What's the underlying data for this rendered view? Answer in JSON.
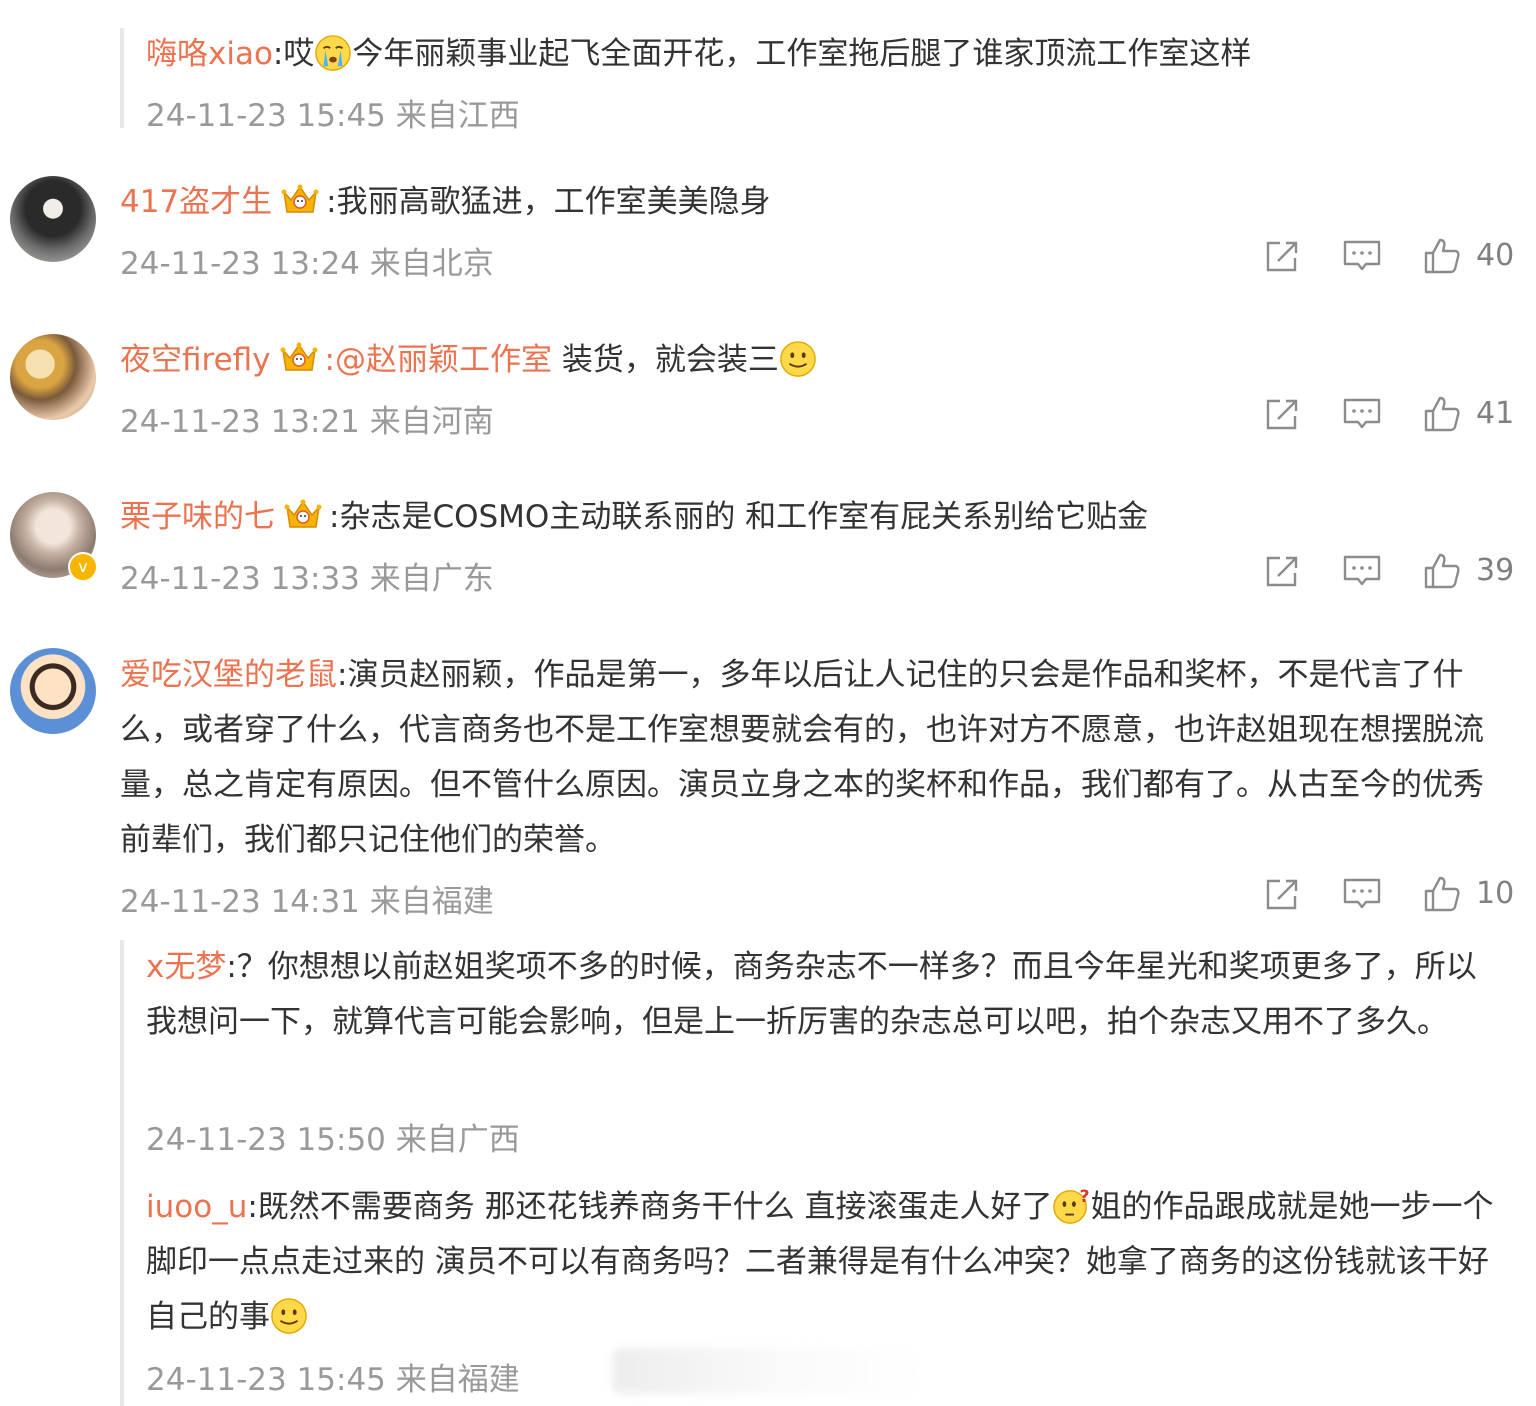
{
  "comments": [
    {
      "name": "417盗才生",
      "text": ":我丽高歌猛进，工作室美美隐身",
      "time": "24-11-23 13:24 来自北京",
      "likes": "40"
    },
    {
      "name": "夜空firefly",
      "mention": ":@赵丽颖工作室",
      "text": " 装货，就会装三",
      "time": "24-11-23 13:21 来自河南",
      "likes": "41"
    },
    {
      "name": "栗子味的七",
      "text": ":杂志是COSMO主动联系丽的 和工作室有屁关系别给它贴金",
      "time": "24-11-23 13:33 来自广东",
      "likes": "39"
    },
    {
      "name": "爱吃汉堡的老鼠",
      "text": ":演员赵丽颖，作品是第一，多年以后让人记住的只会是作品和奖杯，不是代言了什么，或者穿了什么，代言商务也不是工作室想要就会有的，也许对方不愿意，也许赵姐现在想摆脱流量，总之肯定有原因。但不管什么原因。演员立身之本的奖杯和作品，我们都有了。从古至今的优秀前辈们，我们都只记住他们的荣誉。",
      "time": "24-11-23 14:31 来自福建",
      "likes": "10"
    }
  ],
  "replies": {
    "top": {
      "name": "嗨咯xiao",
      "text_a": ":哎",
      "text_b": "今年丽颖事业起飞全面开花，工作室拖后腿了谁家顶流工作室这样",
      "time": "24-11-23 15:45 来自江西"
    },
    "r1": {
      "name": "x无梦",
      "text": ":？你想想以前赵姐奖项不多的时候，商务杂志不一样多？而且今年星光和奖项更多了，所以我想问一下，就算代言可能会影响，但是上一折厉害的杂志总可以吧，拍个杂志又用不了多久。",
      "time": "24-11-23 15:50 来自广西"
    },
    "r2": {
      "name": "iuoo_u",
      "text_a": ":既然不需要商务 那还花钱养商务干什么 直接滚蛋走人好了",
      "text_b": "姐的作品跟成就是她一步一个脚印一点点走过来的 演员不可以有商务吗？二者兼得是有什么冲突？她拿了商务的这份钱就该干好自己的事",
      "time": "24-11-23 15:45 来自福建"
    }
  },
  "icons": {
    "share": "share-icon",
    "comment": "comment-icon",
    "like": "like-icon"
  },
  "colors": {
    "username": "#eb7350",
    "meta": "#999999",
    "text": "#333333"
  }
}
